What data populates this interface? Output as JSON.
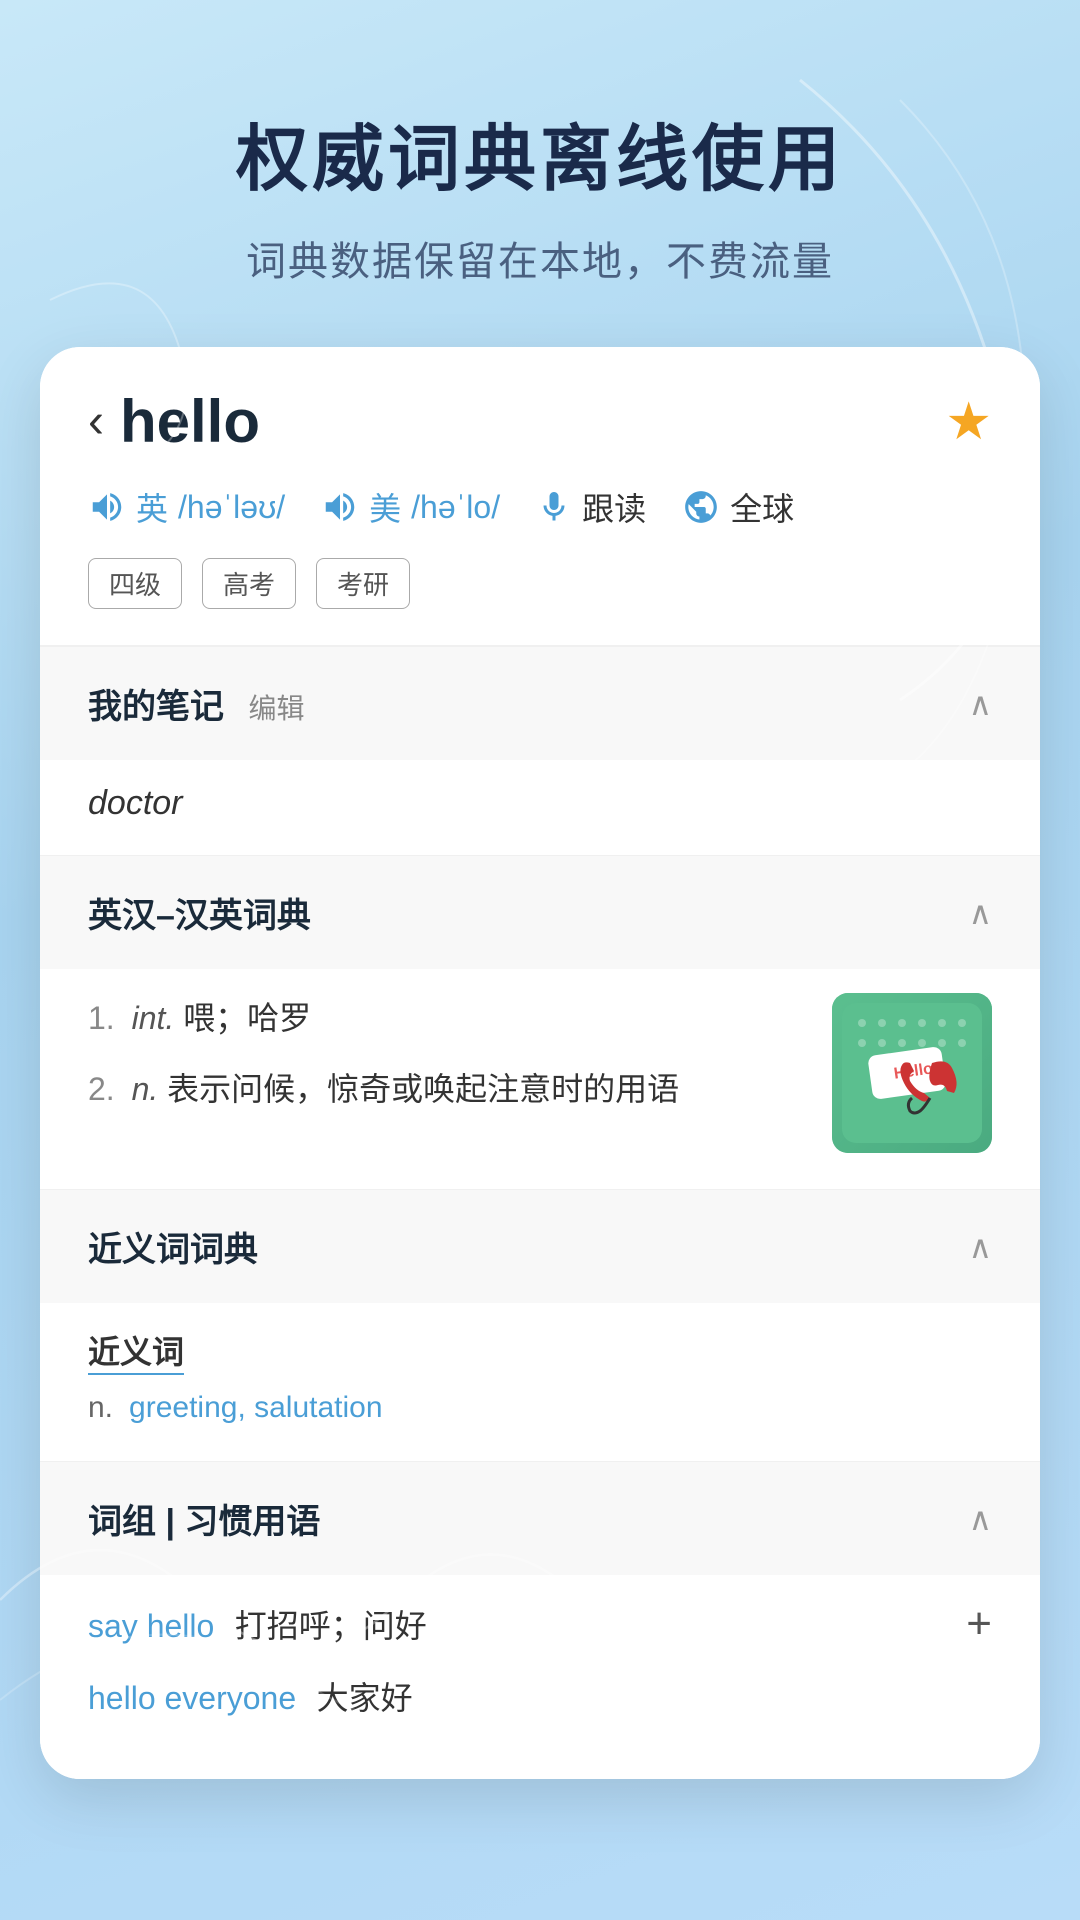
{
  "hero": {
    "title": "权威词典离线使用",
    "subtitle": "词典数据保留在本地，不费流量"
  },
  "word": {
    "back_label": "‹",
    "word_text": "hello",
    "star_icon": "★",
    "pron_en_label": "英",
    "pron_en_ipa": "/həˈləʊ/",
    "pron_us_label": "美",
    "pron_us_ipa": "/həˈlo/",
    "follow_label": "跟读",
    "global_label": "全球",
    "tags": [
      "四级",
      "高考",
      "考研"
    ]
  },
  "sections": {
    "notes": {
      "title": "我的笔记",
      "edit_label": "编辑",
      "content": "doctor"
    },
    "dictionary": {
      "title": "英汉–汉英词典",
      "definitions": [
        {
          "num": "1.",
          "pos": "int.",
          "text": "喂；哈罗"
        },
        {
          "num": "2.",
          "pos": "n.",
          "text": "表示问候，惊奇或唤起注意时的用语"
        }
      ]
    },
    "synonym": {
      "title": "近义词词典",
      "label": "近义词",
      "pos": "n.",
      "words": "greeting, salutation"
    },
    "phrases": {
      "title": "词组 | 习惯用语",
      "items": [
        {
          "phrase": "say hello",
          "meaning": "打招呼；问好",
          "has_add": true
        },
        {
          "phrase": "hello everyone",
          "meaning": "大家好",
          "has_add": false
        }
      ]
    }
  }
}
